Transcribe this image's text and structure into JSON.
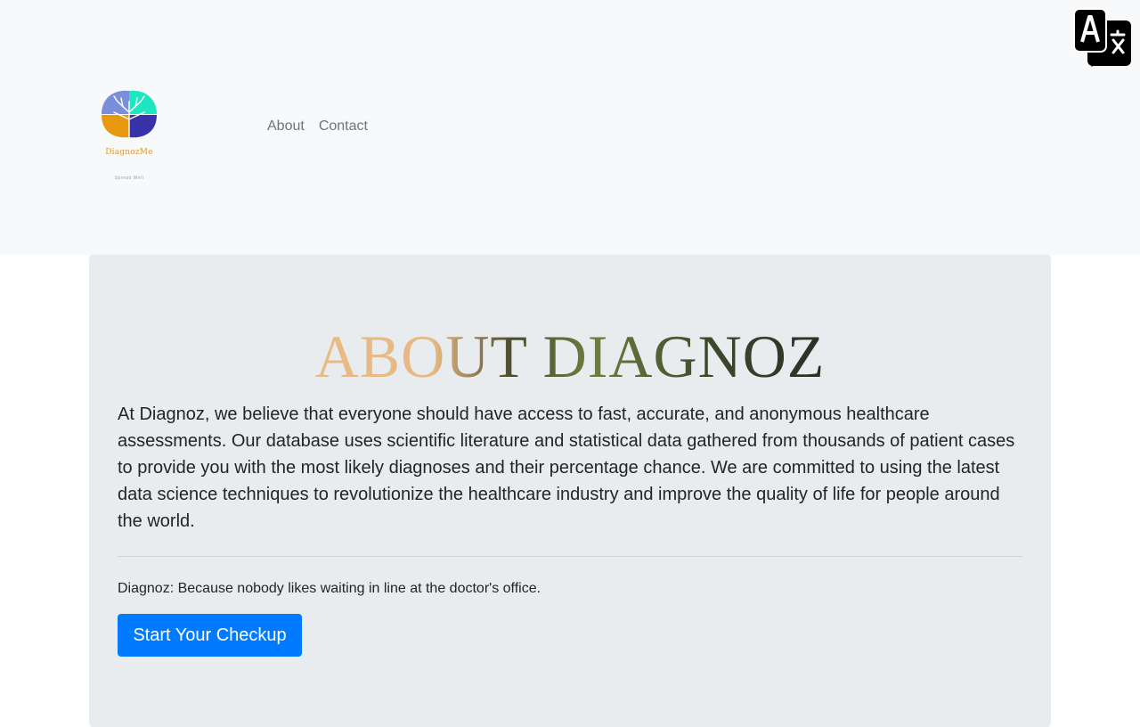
{
  "header": {
    "logo": {
      "name": "DiagnozMe",
      "tagline": "Spread Well"
    },
    "nav": [
      {
        "label": "About"
      },
      {
        "label": "Contact"
      }
    ],
    "translate_icon": "translate-icon"
  },
  "main": {
    "title": "ABOUT DIAGNOZ",
    "description": "At Diagnoz, we believe that everyone should have access to fast, accurate, and anonymous healthcare assessments. Our database uses scientific literature and statistical data gathered from thousands of patient cases to provide you with the most likely diagnoses and their percentage chance. We are committed to using the latest data science techniques to revolutionize the healthcare industry and improve the quality of life for people around the world.",
    "tagline": "Diagnoz: Because nobody likes waiting in line at the doctor's office.",
    "cta_label": "Start Your Checkup"
  },
  "colors": {
    "header_bg": "#f8f9fa",
    "jumbotron_bg": "#e9ecef",
    "primary": "#007bff",
    "nav_link": "#6c757d"
  }
}
